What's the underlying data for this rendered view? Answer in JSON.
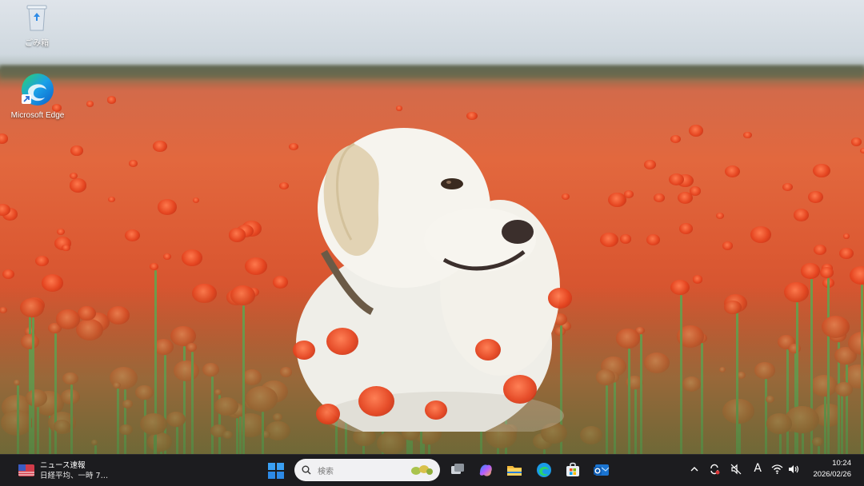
{
  "desktop": {
    "icons": [
      {
        "label": "ごみ箱",
        "icon": "recycle-bin-icon"
      },
      {
        "label": "Microsoft Edge",
        "icon": "edge-icon"
      }
    ]
  },
  "taskbar": {
    "widget": {
      "title": "ニュース速報",
      "headline": "日経平均、一時 7…"
    },
    "search": {
      "placeholder": "検索"
    },
    "apps": [
      "start-icon",
      "task-view-icon",
      "copilot-icon",
      "file-explorer-icon",
      "edge-icon",
      "microsoft-store-icon",
      "outlook-icon"
    ],
    "tray": {
      "ime": "A",
      "time": "10:24",
      "date": "2026/02/26"
    }
  },
  "colors": {
    "taskbar": "#1c1c1f",
    "accent": "#0a84ff"
  }
}
